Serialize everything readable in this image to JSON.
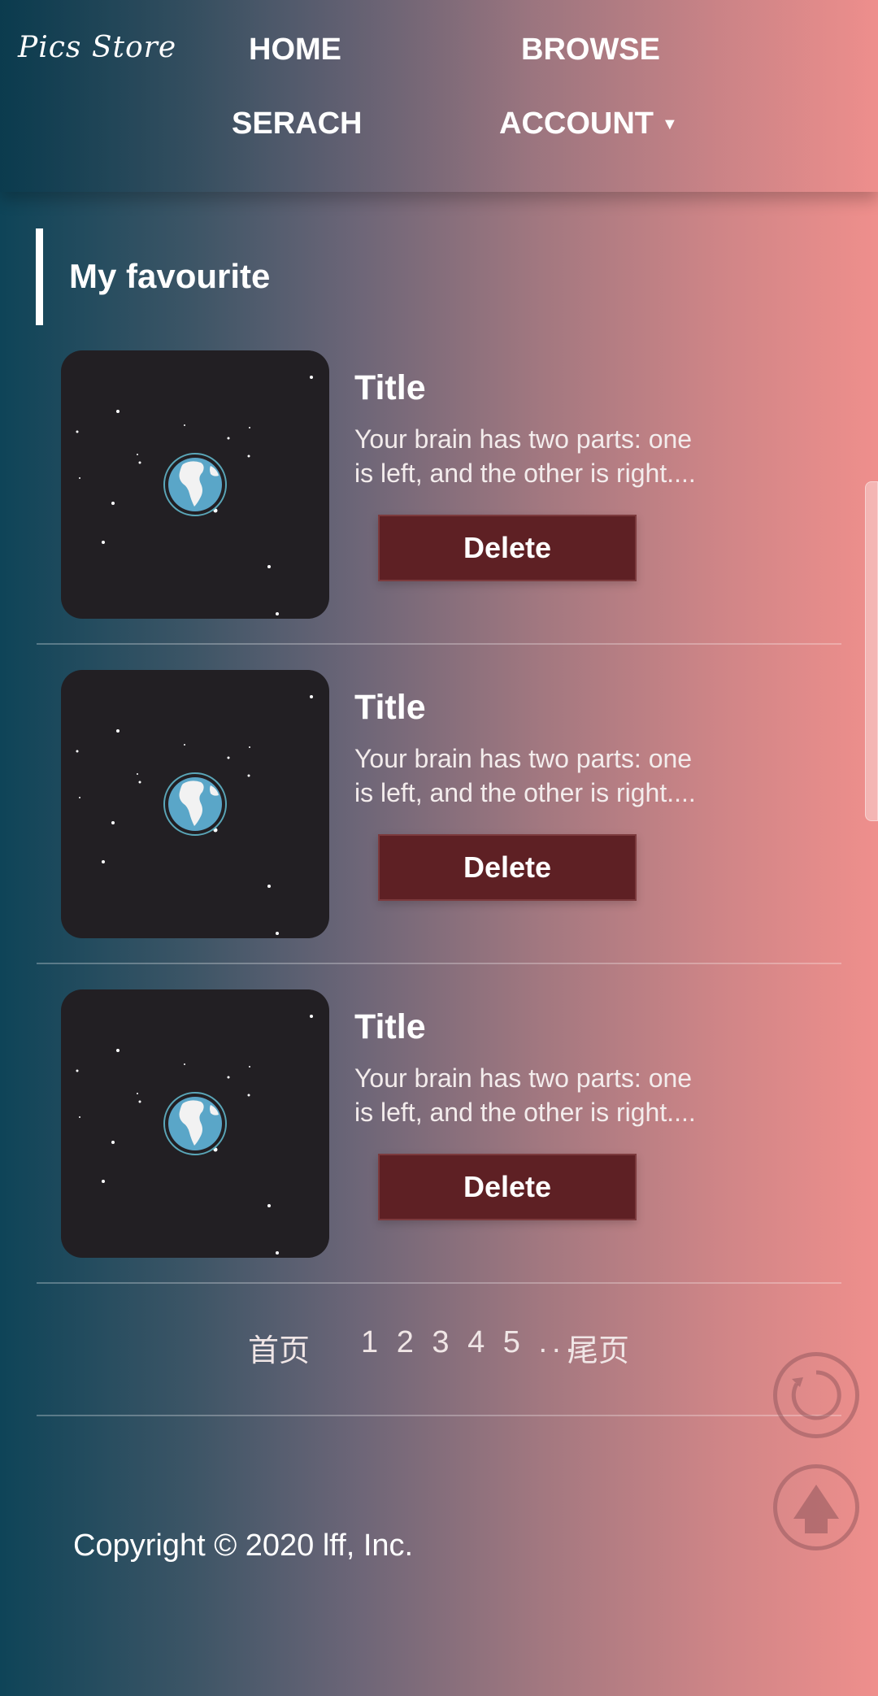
{
  "header": {
    "logo": "Pics Store",
    "nav": {
      "home": "HOME",
      "browse": "BROWSE",
      "search": "SERACH",
      "account": "ACCOUNT",
      "account_caret": "▼"
    }
  },
  "section": {
    "title": "My favourite"
  },
  "cards": [
    {
      "title": "Title",
      "desc_line1": "Your brain has two parts: one",
      "desc_line2": "is left, and the other is right....",
      "delete_label": "Delete"
    },
    {
      "title": "Title",
      "desc_line1": "Your brain has two parts: one",
      "desc_line2": "is left, and the other is right....",
      "delete_label": "Delete"
    },
    {
      "title": "Title",
      "desc_line1": "Your brain has two parts: one",
      "desc_line2": "is left, and the other is right....",
      "delete_label": "Delete"
    }
  ],
  "pagination": {
    "first": "首页",
    "numbers": "1 2 3 4 5 ...",
    "last": "尾页"
  },
  "footer": {
    "copyright": "Copyright © 2020 lff, Inc."
  },
  "icons": {
    "refresh": "refresh-icon",
    "back_to_top": "arrow-up-icon",
    "thumbnail": "earth-in-space-icon"
  },
  "colors": {
    "delete_button": "#5e2024",
    "thumbnail_bg": "#221f23",
    "gradient_left": "#0e4458",
    "gradient_right": "#ef8f8c"
  }
}
